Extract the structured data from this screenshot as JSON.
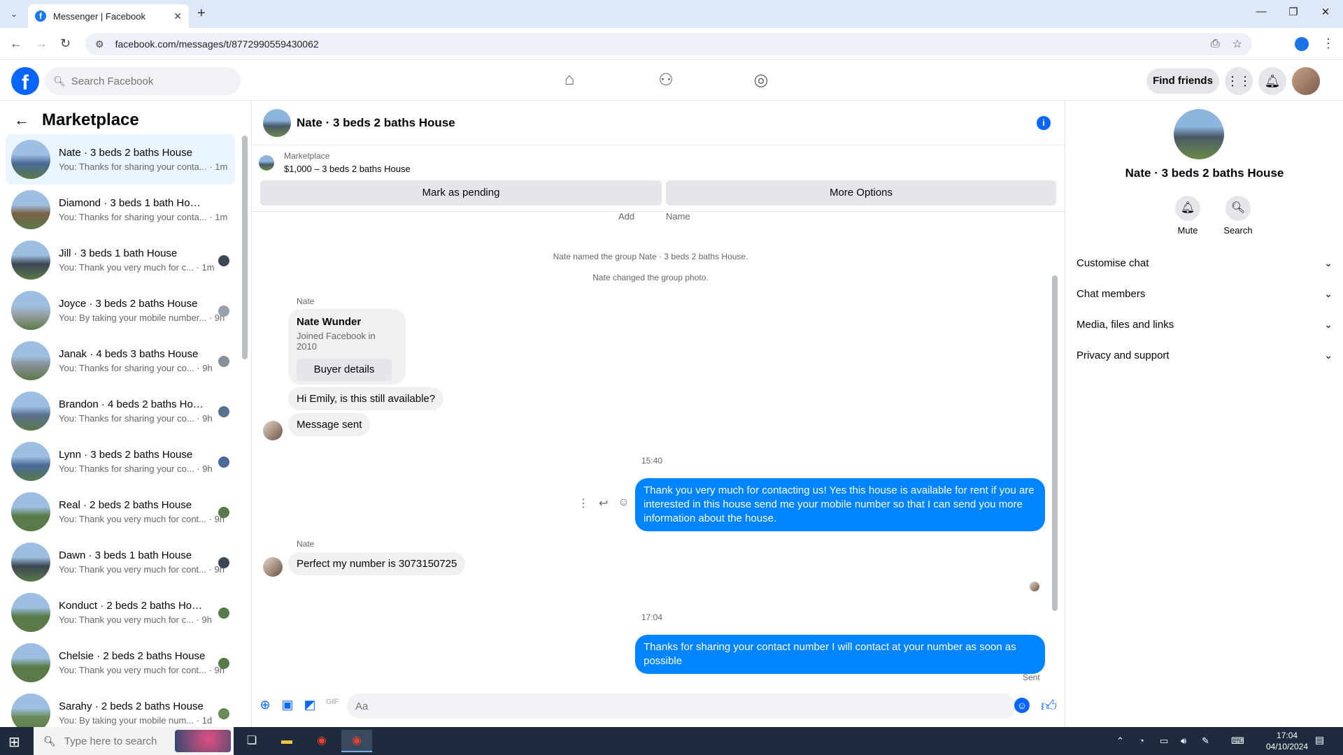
{
  "browser": {
    "tab_title": "Messenger | Facebook",
    "url": "facebook.com/messages/t/8772990559430062"
  },
  "fb_header": {
    "search_placeholder": "Search Facebook",
    "find_friends_label": "Find friends"
  },
  "left_panel": {
    "title": "Marketplace",
    "conversations": [
      {
        "name": "Nate · 3 beds 2 baths House",
        "preview": "You: Thanks for sharing your conta... · 1m",
        "color": "#4a6a9a"
      },
      {
        "name": "Diamond · 3 beds 1 bath House",
        "preview": "You: Thanks for sharing your conta... · 1m",
        "color": "#7a6048"
      },
      {
        "name": "Jill · 3 beds 1 bath House",
        "preview": "You: Thank you very much for c... · 1m",
        "color": "#3c4654"
      },
      {
        "name": "Joyce · 3 beds 2 baths House",
        "preview": "You: By taking your mobile number... · 9h",
        "color": "#9aa0a8"
      },
      {
        "name": "Janak · 4 beds 3 baths House",
        "preview": "You: Thanks for sharing your co... · 9h",
        "color": "#8a9098"
      },
      {
        "name": "Brandon · 4 beds 2 baths Hou...",
        "preview": "You: Thanks for sharing your co... · 9h",
        "color": "#5a7090"
      },
      {
        "name": "Lynn · 3 beds 2 baths House",
        "preview": "You: Thanks for sharing your co... · 9h",
        "color": "#4a6a9a"
      },
      {
        "name": "Real · 2 beds 2 baths House",
        "preview": "You: Thank you very much for cont... · 9h",
        "color": "#5a7a48"
      },
      {
        "name": "Dawn · 3 beds 1 bath House",
        "preview": "You: Thank you very much for cont... · 9h",
        "color": "#3c4654"
      },
      {
        "name": "Konduct · 2 beds 2 baths House",
        "preview": "You: Thank you very much for c... · 9h",
        "color": "#5a7a48"
      },
      {
        "name": "Chelsie · 2 beds 2 baths House",
        "preview": "You: Thank you very much for cont... · 9h",
        "color": "#5a7a48"
      },
      {
        "name": "Sarahy · 2 beds 2 baths House",
        "preview": "You: By taking your mobile num... · 1d",
        "color": "#6a8a58"
      }
    ]
  },
  "chat": {
    "title": "Nate · 3 beds 2 baths House",
    "marketplace_label": "Marketplace",
    "listing": "$1,000 – 3 beds 2 baths House",
    "mark_pending_label": "Mark as pending",
    "more_options_label": "More Options",
    "cut_add": "Add",
    "cut_name": "Name",
    "sys1": "Nate named the group Nate · 3 beds 2 baths House.",
    "sys2": "Nate changed the group photo.",
    "sender1": "Nate",
    "card_name": "Nate Wunder",
    "card_sub": "Joined Facebook in 2010",
    "card_btn": "Buyer details",
    "msg_in1": "Hi Emily, is this still available?",
    "msg_in2": "Message sent",
    "time1": "15:40",
    "msg_out1": "Thank you very much for contacting us! Yes this house is available for rent if you are interested in this house send me your mobile number so that I can send you more information about the house.",
    "sender2": "Nate",
    "msg_in3": "Perfect my number is 3073150725",
    "time2": "17:04",
    "msg_out2": "Thanks for sharing your contact number I will contact at your number as soon as possible",
    "sent_label": "Sent",
    "composer_placeholder": "Aa"
  },
  "right_panel": {
    "name": "Nate · 3 beds 2 baths House",
    "mute_label": "Mute",
    "search_label": "Search",
    "sections": [
      "Customise chat",
      "Chat members",
      "Media, files and links",
      "Privacy and support"
    ]
  },
  "taskbar": {
    "search_placeholder": "Type here to search",
    "time": "17:04",
    "date": "04/10/2024"
  }
}
